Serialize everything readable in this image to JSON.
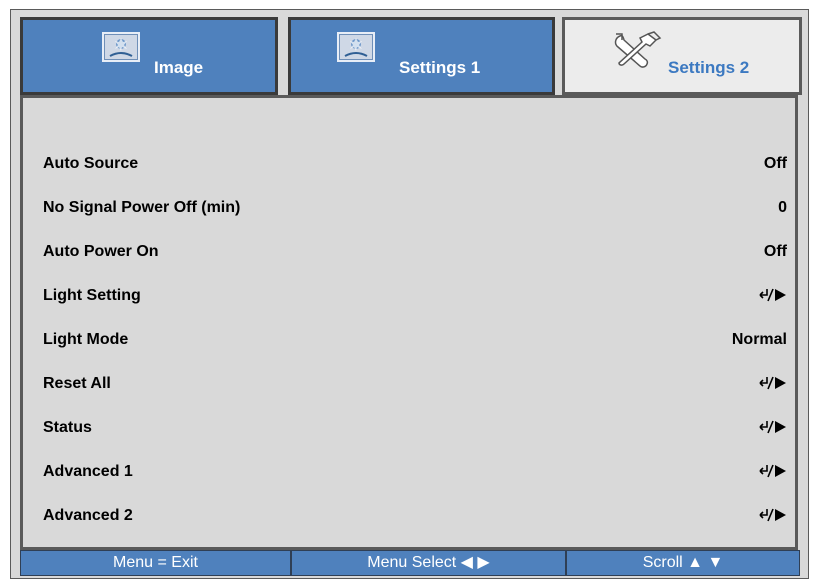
{
  "tabs": [
    {
      "label": "Image",
      "icon": "image-icon"
    },
    {
      "label": "Settings 1",
      "icon": "image-icon"
    },
    {
      "label": "Settings 2",
      "icon": "tools-icon"
    }
  ],
  "rows": [
    {
      "label": "Auto Source",
      "value": "Off"
    },
    {
      "label": "No Signal Power Off (min)",
      "value": "0"
    },
    {
      "label": "Auto Power On",
      "value": "Off"
    },
    {
      "label": "Light Setting",
      "value": "",
      "icon": "enter-right-icon"
    },
    {
      "label": "Light Mode",
      "value": "Normal"
    },
    {
      "label": "Reset All",
      "value": "",
      "icon": "enter-right-icon"
    },
    {
      "label": "Status",
      "value": "",
      "icon": "enter-right-icon"
    },
    {
      "label": "Advanced 1",
      "value": "",
      "icon": "enter-right-icon"
    },
    {
      "label": "Advanced 2",
      "value": "",
      "icon": "enter-right-icon"
    }
  ],
  "footer": {
    "exit": "Menu = Exit",
    "select": "Menu Select ◀ ▶",
    "scroll": "Scroll ▲ ▼"
  },
  "colors": {
    "accent": "#4f81bd",
    "panel": "#d9d9d9",
    "selected_tab_text": "#3c79c1"
  }
}
